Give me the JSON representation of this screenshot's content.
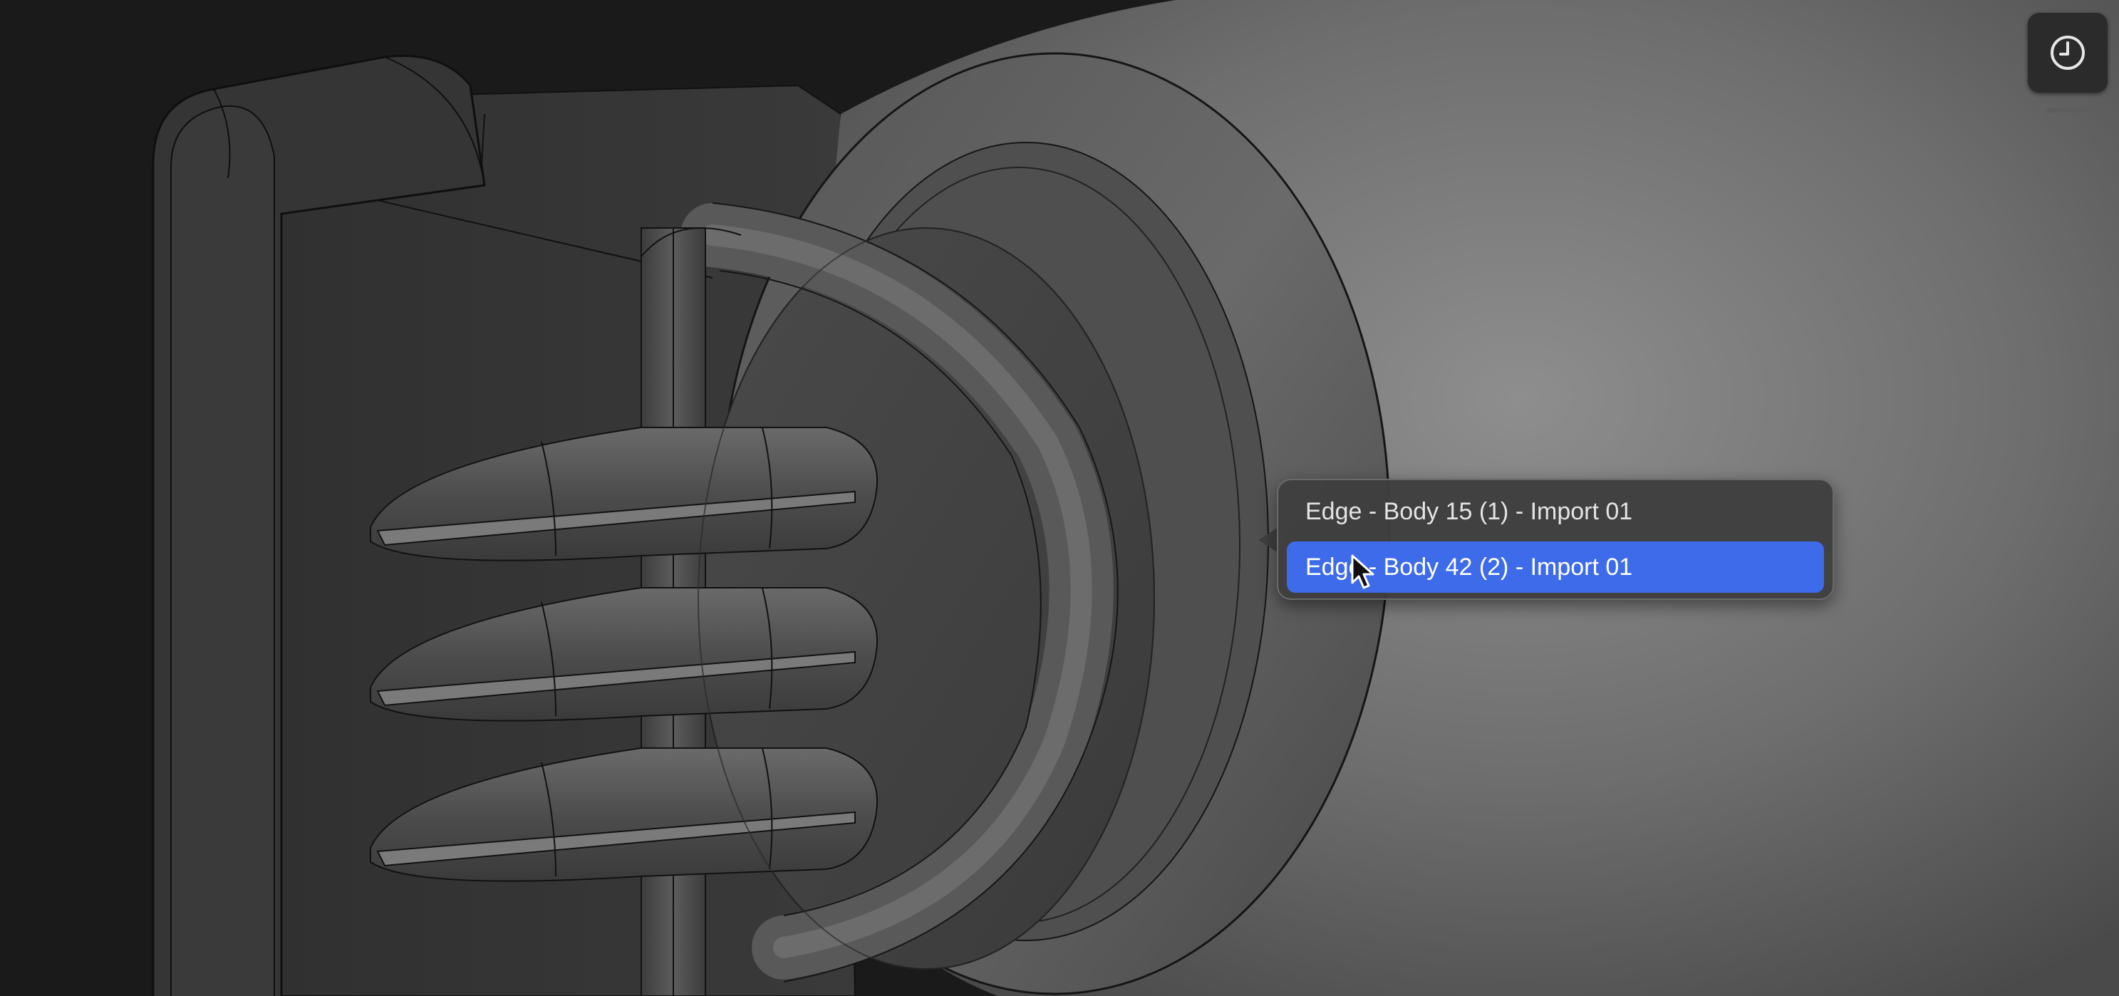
{
  "popup": {
    "items": [
      {
        "label": "Edge - Body 15 (1) - Import 01",
        "selected": false
      },
      {
        "label": "Edge - Body 42 (2) - Import 01",
        "selected": true
      }
    ]
  },
  "toolbar": {
    "history_icon": "clock-icon"
  },
  "colors": {
    "selection": "#3e6bea",
    "background": "#1a1a1a",
    "popup_bg": "#3e3e3e"
  }
}
